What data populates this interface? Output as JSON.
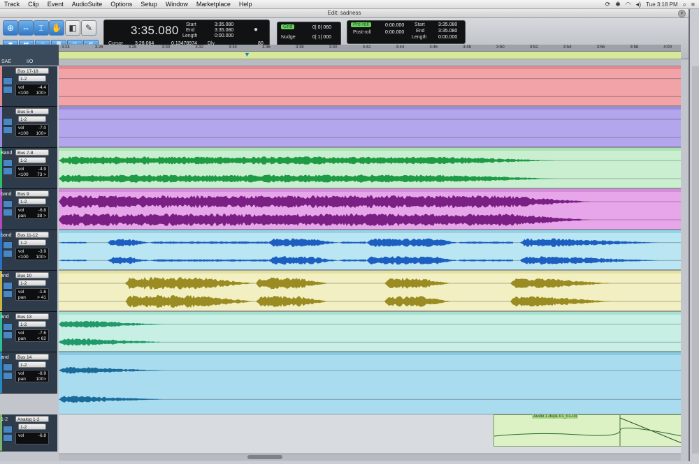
{
  "menubar": {
    "items": [
      "Track",
      "Clip",
      "Event",
      "AudioSuite",
      "Options",
      "Setup",
      "Window",
      "Marketplace",
      "Help"
    ],
    "clock": "Tue 3:18 PM"
  },
  "window": {
    "title": "Edit: sadness"
  },
  "counter": {
    "main": "3:35.080",
    "start_label": "Start",
    "end_label": "End",
    "length_label": "Length",
    "start": "3:35.080",
    "end": "3:35.080",
    "length": "0:00.000",
    "cursor_label": "Cursor",
    "cursor": "3:28.064",
    "sample": "0.13478974",
    "dly_label": "Dly",
    "nudge_val": "80"
  },
  "grid": {
    "grid_label": "Grid",
    "grid_value": "0| 0| 060",
    "nudge_label": "Nudge",
    "nudge_value": "0| 1| 000"
  },
  "transport": {
    "preroll_label": "Pre-roll",
    "postroll_label": "Post-roll",
    "preroll": "0:00.000",
    "postroll": "0:00.000",
    "start_label": "Start",
    "end_label": "End",
    "length_label": "Length",
    "start": "3:35.080",
    "end": "3:35.080",
    "length": "0:00.000"
  },
  "ruler": {
    "ticks": [
      "3:24",
      "3:26",
      "3:28",
      "3:30",
      "3:32",
      "3:34",
      "3:36",
      "3:38",
      "3:40",
      "3:42",
      "3:44",
      "3:46",
      "3:48",
      "3:50",
      "3:52",
      "3:54",
      "3:56",
      "3:58",
      "4:00"
    ]
  },
  "headers": {
    "col_label": "SAE",
    "io_label": "I/O"
  },
  "tracks": [
    {
      "name": "",
      "io": "Bus 17-18",
      "sub": "1-2",
      "vol_label": "vol",
      "vol": "-4.4",
      "pan_l": "<100",
      "pan_r": "100>"
    },
    {
      "name": "",
      "io": "Bus 5-6",
      "sub": "1-2",
      "vol_label": "vol",
      "vol": "-7.0",
      "pan_l": "<100",
      "pan_r": "100>"
    },
    {
      "name": "Band",
      "io": "Bus 7-8",
      "sub": "1-2",
      "vol_label": "vol",
      "vol": "-4.9",
      "pan_l": "<100",
      "pan_r": "73 >"
    },
    {
      "name": "band",
      "io": "Bus 9",
      "sub": "1-2",
      "vol_label": "vol",
      "vol": "-6.8",
      "pan_l": "pan",
      "pan_r": "38 >"
    },
    {
      "name": "band",
      "io": "Bus 11-12",
      "sub": "1-2",
      "vol_label": "vol",
      "vol": "-3.9",
      "pan_l": "<100",
      "pan_r": "100>"
    },
    {
      "name": "and",
      "io": "Bus 10",
      "sub": "1-2",
      "vol_label": "vol",
      "vol": "-1.6",
      "pan_l": "pan",
      "pan_r": "> 41"
    },
    {
      "name": "and",
      "io": "Bus 13",
      "sub": "1-2",
      "vol_label": "vol",
      "vol": "-7.6",
      "pan_l": "pan",
      "pan_r": "< 62"
    },
    {
      "name": "and",
      "io": "Bus 14",
      "sub": "1-2",
      "vol_label": "vol",
      "vol": "-8.9",
      "pan_l": "pan",
      "pan_r": "100>"
    },
    {
      "name": "1-2",
      "io": "Analog 1-2",
      "sub": "1-2",
      "vol_label": "vol",
      "vol": "-6.8",
      "pan_l": "",
      "pan_r": ""
    }
  ],
  "lane_colors": {
    "0": {
      "bg": "#f2a3a8",
      "bar": "#e7878e",
      "wave": "#d26a72"
    },
    "1": {
      "bg": "#b3a6ec",
      "bar": "#9a8ae0",
      "wave": "#7d6ad0"
    },
    "2": {
      "bg": "#c9efd0",
      "bar": "#a9e2b3",
      "wave": "#1f9a45"
    },
    "3": {
      "bg": "#e8a6ea",
      "bar": "#d88ada",
      "wave": "#7a1f84"
    },
    "4": {
      "bg": "#b9e6f2",
      "bar": "#94d2e6",
      "wave": "#1d5fc0"
    },
    "5": {
      "bg": "#f2f0c2",
      "bar": "#e4e0a0",
      "wave": "#9a8c22"
    },
    "6": {
      "bg": "#c7efe4",
      "bar": "#a6e2d2",
      "wave": "#1f9a68"
    },
    "7": {
      "bg": "#a9dcef",
      "bar": "#86cbe6",
      "wave": "#1a6a9a"
    }
  },
  "clip_thumb": {
    "label": "Audio 1.dup1.01_01-03"
  }
}
